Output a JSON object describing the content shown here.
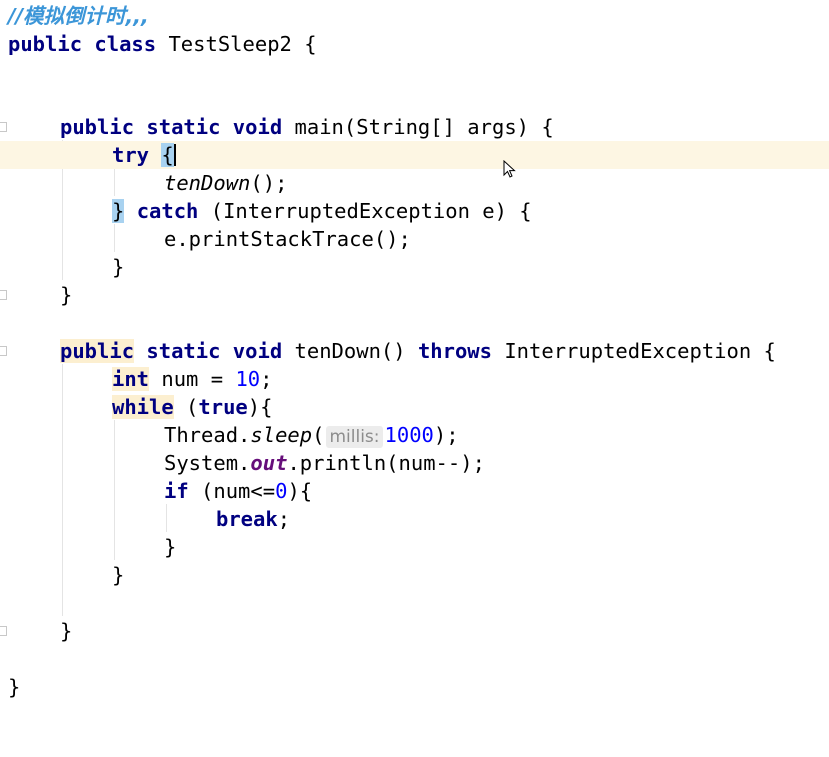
{
  "editor": {
    "comment": "//模拟倒计时,,,",
    "class_decl": {
      "kw": "public class",
      "name": " TestSleep2 {"
    },
    "main": {
      "sig_kw": "public static void",
      "sig_rest": " main(String[] args) {",
      "try_kw": "try",
      "try_brace": "{",
      "call": "tenDown",
      "call_tail": "();",
      "close_brace": "}",
      "catch_kw": "catch",
      "catch_rest": " (InterruptedException e) {",
      "print_trace": "e.printStackTrace();",
      "inner_close": "}",
      "method_close": "}"
    },
    "tendown": {
      "public_kw": "public",
      "static_void_kw": " static void",
      "name_rest": " tenDown() ",
      "throws_kw": "throws",
      "throws_rest": " InterruptedException {",
      "int_kw": "int",
      "num_decl": " num = ",
      "num_value": "10",
      "semi": ";",
      "while_kw": "while",
      "paren_open": " (",
      "true_kw": "true",
      "paren_close": "){",
      "thread": "Thread.",
      "sleep": "sleep",
      "sleep_open": "(",
      "param_hint": "millis:",
      "sleep_arg": "1000",
      "sleep_close": ");",
      "system": "System.",
      "out": "out",
      "println": ".println(num--);",
      "if_kw": "if",
      "if_cond": " (num<=",
      "zero": "0",
      "if_close": "){",
      "break_kw": "break",
      "break_semi": ";",
      "if_end": "}",
      "while_end": "}",
      "method_end": "}"
    },
    "class_end": "}"
  }
}
